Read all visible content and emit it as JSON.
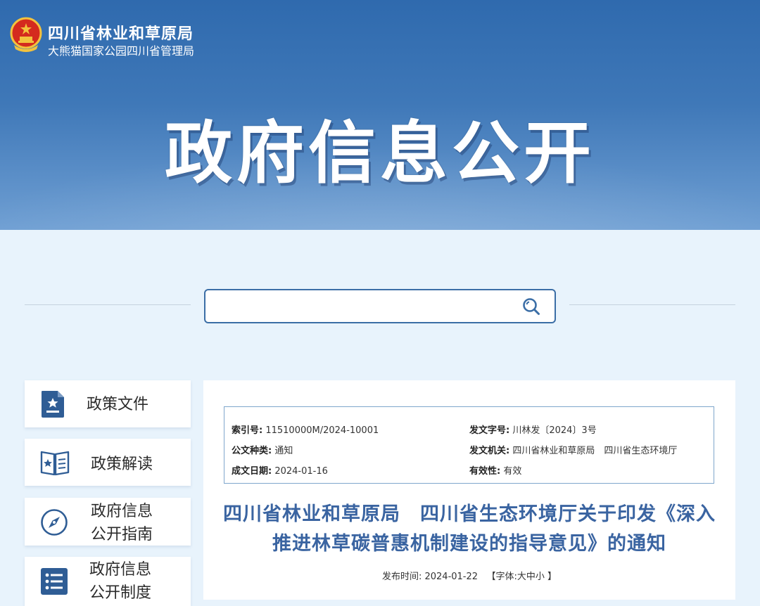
{
  "header": {
    "org_name": "四川省林业和草原局",
    "org_sub": "大熊猫国家公园四川省管理局",
    "banner_title": "政府信息公开"
  },
  "search": {
    "placeholder": ""
  },
  "sidebar": {
    "items": [
      {
        "line1": "政策文件",
        "line2": "",
        "icon": "document-star-icon"
      },
      {
        "line1": "政策解读",
        "line2": "",
        "icon": "book-star-icon"
      },
      {
        "line1": "政府信息",
        "line2": "公开指南",
        "icon": "compass-icon"
      },
      {
        "line1": "政府信息",
        "line2": "公开制度",
        "icon": "list-icon"
      }
    ]
  },
  "doc": {
    "meta": {
      "index_label": "索引号:",
      "index_value": "11510000M/2024-10001",
      "docno_label": "发文字号:",
      "docno_value": "川林发〔2024〕3号",
      "type_label": "公文种类:",
      "type_value": "通知",
      "issuer_label": "发文机关:",
      "issuer_value": "四川省林业和草原局　四川省生态环境厅",
      "date_label": "成文日期:",
      "date_value": "2024-01-16",
      "validity_label": "有效性:",
      "validity_value": "有效"
    },
    "title_line1": "四川省林业和草原局　四川省生态环境厅关于印发《深入",
    "title_line2": "推进林草碳普惠机制建设的指导意见》的通知",
    "publish_label": "发布时间:",
    "publish_date": "2024-01-22",
    "font_prefix": "【字体:",
    "font_large": "大",
    "font_medium": "中",
    "font_small": "小",
    "font_suffix": "】"
  },
  "colors": {
    "banner_top": "#2f6aae",
    "accent": "#3a64a1",
    "page_bg": "#e8f3fc"
  }
}
